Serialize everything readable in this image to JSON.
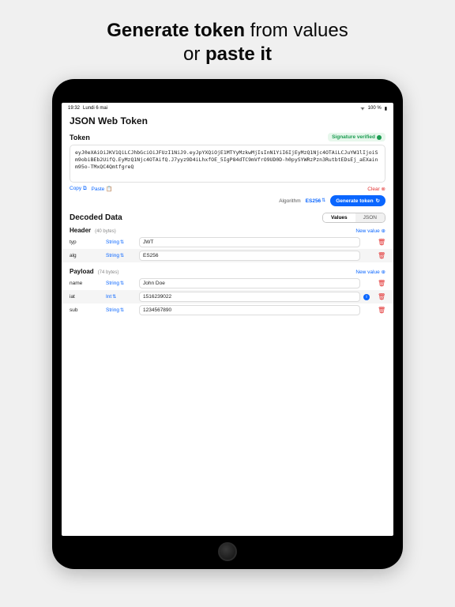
{
  "marketing": {
    "line1_bold": "Generate token",
    "line1_rest": " from values",
    "line2_pre": "or ",
    "line2_bold": "paste it"
  },
  "status": {
    "time": "19:32",
    "date": "Lundi 6 mai",
    "battery": "100 %",
    "wifi": "wifi"
  },
  "app_title": "JSON Web Token",
  "token": {
    "section_label": "Token",
    "signature_badge": "Signature verified",
    "raw": "eyJ0eXAiOiJKV1QiLCJhbGciOiJFUzI1NiJ9.eyJpYXQiOjE1MTYyMzkwMjIsInN1YiI6IjEyMzQ1Njc4OTAiLCJuYW1lIjoiSm9obiBEb2UifQ.EyMzQ1Njc4OTAifQ.J7yyz9D4iLhxfOE_5IgP84dTC9mVfrO9UD0D-h0pySYWRzPzn3RutbtEDsEj_aEXainm95o-TMxQC4QmtfgreQ",
    "copy": "Copy",
    "paste": "Paste",
    "clear": "Clear"
  },
  "algo": {
    "label": "Algorithm",
    "value": "ES256",
    "generate": "Generate token"
  },
  "decoded": {
    "title": "Decoded Data",
    "seg_values": "Values",
    "seg_json": "JSON"
  },
  "header_block": {
    "label": "Header",
    "bytes": "(40 bytes)",
    "newvalue": "New value",
    "rows": [
      {
        "key": "typ",
        "type": "String",
        "value": "JWT"
      },
      {
        "key": "alg",
        "type": "String",
        "value": "ES256"
      }
    ]
  },
  "payload_block": {
    "label": "Payload",
    "bytes": "(74 bytes)",
    "newvalue": "New value",
    "rows": [
      {
        "key": "name",
        "type": "String",
        "value": "John Doe"
      },
      {
        "key": "iat",
        "type": "Int",
        "value": "1516239022",
        "info": true
      },
      {
        "key": "sub",
        "type": "String",
        "value": "1234567890"
      }
    ]
  }
}
